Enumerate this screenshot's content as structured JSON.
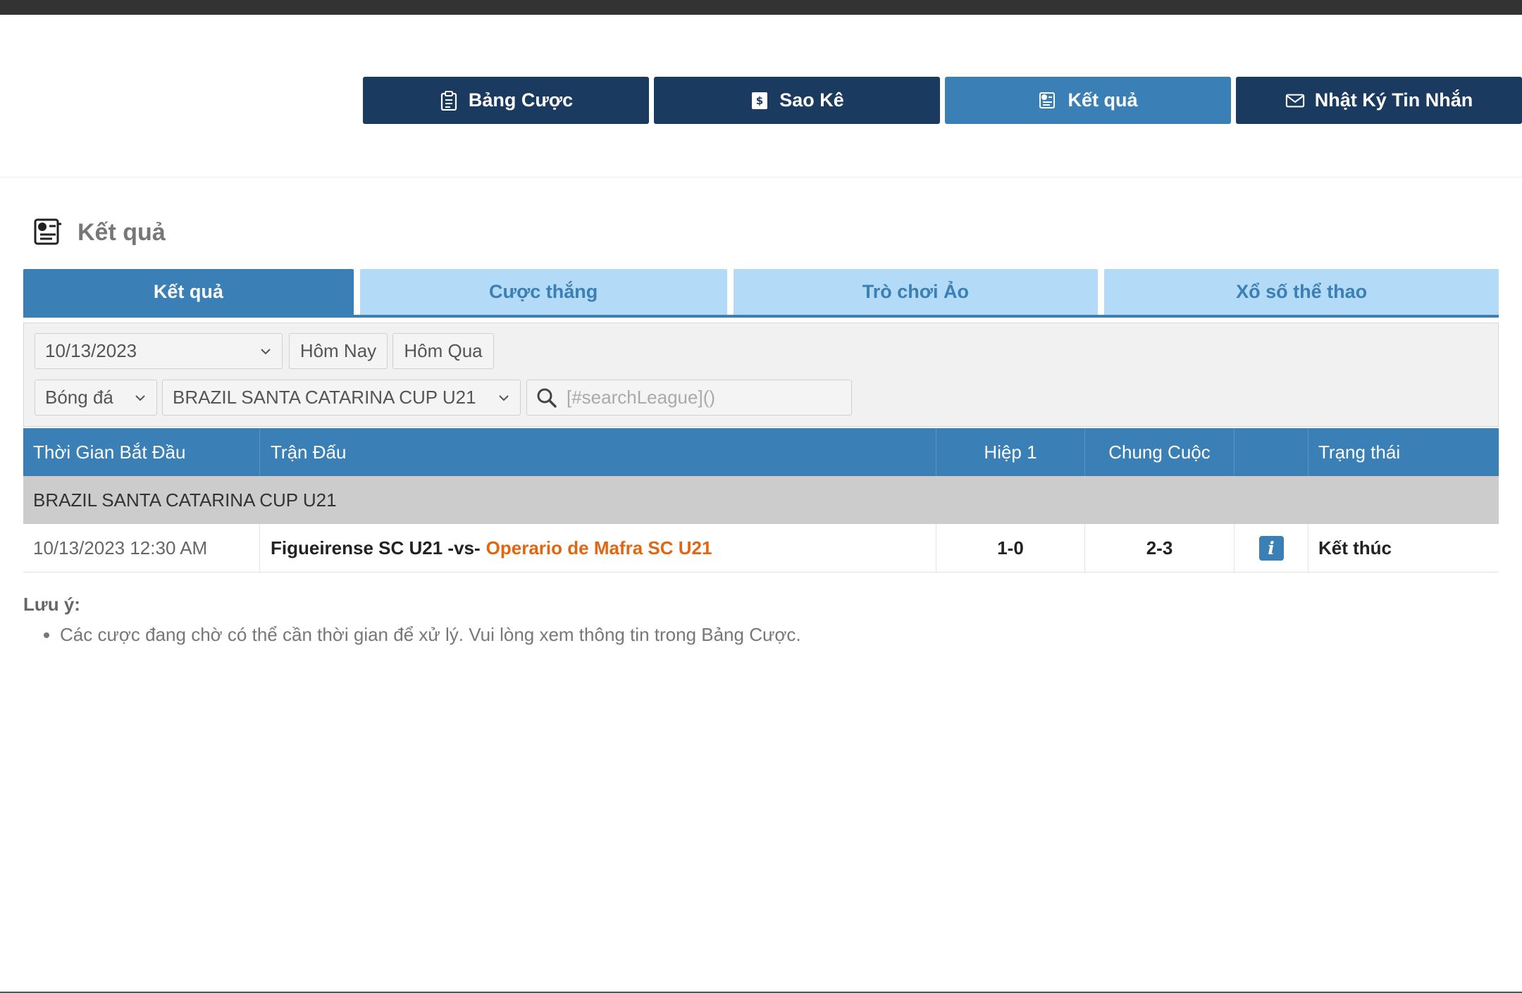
{
  "nav": {
    "items": [
      {
        "label": "Bảng Cược",
        "icon": "clipboard-icon"
      },
      {
        "label": "Sao Kê",
        "icon": "statement-icon"
      },
      {
        "label": "Kết quả",
        "icon": "results-icon"
      },
      {
        "label": "Nhật Ký Tin Nhắn",
        "icon": "mail-icon"
      }
    ],
    "active_index": 2
  },
  "section": {
    "title": "Kết quả",
    "icon": "results-icon"
  },
  "tabs": [
    {
      "label": "Kết quả",
      "active": true
    },
    {
      "label": "Cược thắng",
      "active": false
    },
    {
      "label": "Trò chơi Ảo",
      "active": false
    },
    {
      "label": "Xổ số thể thao",
      "active": false
    }
  ],
  "filter": {
    "date": "10/13/2023",
    "today_label": "Hôm Nay",
    "yesterday_label": "Hôm Qua",
    "sport": "Bóng đá",
    "league": "BRAZIL SANTA CATARINA CUP U21",
    "search_placeholder": "[#searchLeague]()"
  },
  "table": {
    "headers": {
      "start_time": "Thời Gian Bắt Đầu",
      "match": "Trận Đấu",
      "half1": "Hiệp 1",
      "fulltime": "Chung Cuộc",
      "info": "",
      "status": "Trạng thái"
    },
    "groups": [
      {
        "league": "BRAZIL SANTA CATARINA CUP U21",
        "rows": [
          {
            "start_time": "10/13/2023 12:30 AM",
            "home": "Figueirense SC U21 -vs-",
            "away": "Operario de Mafra SC U21",
            "half1": "1-0",
            "fulltime": "2-3",
            "status": "Kết thúc"
          }
        ]
      }
    ]
  },
  "note": {
    "label": "Lưu ý:",
    "items": [
      "Các cược đang chờ có thể cần thời gian để xử lý. Vui lòng xem thông tin trong Bảng Cược."
    ]
  },
  "colors": {
    "nav_dark": "#1b3a5f",
    "accent": "#3a7fb5",
    "tab_inactive": "#b3daf7",
    "away_team": "#e2660f",
    "group_row": "#cccccc"
  }
}
